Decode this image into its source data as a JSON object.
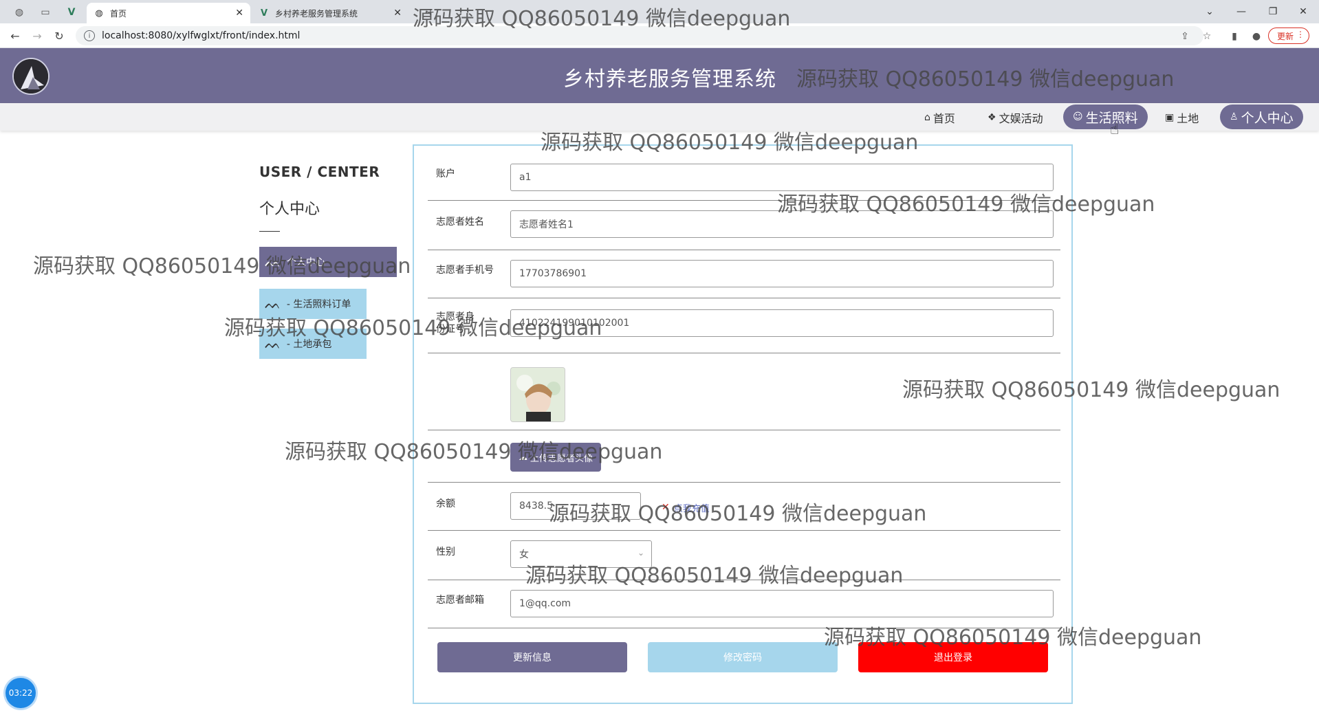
{
  "browser": {
    "tabs": [
      {
        "label": "首页",
        "active": true
      },
      {
        "label": "乡村养老服务管理系统",
        "active": false
      }
    ],
    "url": "localhost:8080/xylfwglxt/front/index.html",
    "update_label": "更新"
  },
  "header": {
    "title": "乡村养老服务管理系统"
  },
  "nav": {
    "items": [
      {
        "label": "首页",
        "icon": "home-icon"
      },
      {
        "label": "文娱活动",
        "icon": "book-icon"
      },
      {
        "label": "生活照料",
        "icon": "care-icon"
      },
      {
        "label": "土地",
        "icon": "gift-icon"
      },
      {
        "label": "个人中心",
        "icon": "user-icon"
      }
    ]
  },
  "sidebar": {
    "title": "USER / CENTER",
    "subtitle": "个人中心",
    "items": [
      {
        "label": "个人中心",
        "active": true
      },
      {
        "label": "- 生活照料订单"
      },
      {
        "label": "- 土地承包"
      }
    ]
  },
  "form": {
    "account": {
      "label": "账户",
      "value": "a1"
    },
    "name": {
      "label": "志愿者姓名",
      "value": "志愿者姓名1"
    },
    "phone": {
      "label": "志愿者手机号",
      "value": "17703786901"
    },
    "idcard": {
      "label": "志愿者身份证号",
      "value": "410224199010102001"
    },
    "upload_label": "上传志愿者头像",
    "balance": {
      "label": "余额",
      "value": "8438.5",
      "recharge_label": "点我充值"
    },
    "gender": {
      "label": "性别",
      "value": "女"
    },
    "email": {
      "label": "志愿者邮箱",
      "value": "1@qq.com"
    },
    "buttons": {
      "update": "更新信息",
      "password": "修改密码",
      "logout": "退出登录"
    }
  },
  "colors": {
    "brand": "#6f6b93",
    "light_blue": "#a6d6ec",
    "danger": "#ff0000"
  },
  "clock": "03:22",
  "watermark": "源码获取 QQ86050149 微信deepguan"
}
